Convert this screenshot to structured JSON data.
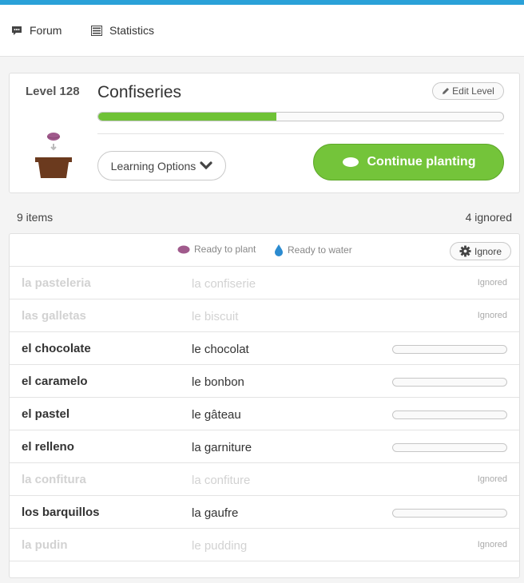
{
  "nav": {
    "items": [
      {
        "label": "Forum",
        "icon": "speech-bubble-icon"
      },
      {
        "label": "Statistics",
        "icon": "list-table-icon"
      }
    ]
  },
  "level": {
    "label": "Level 128",
    "title": "Confiseries",
    "edit_label": "Edit Level",
    "progress": 0.44,
    "learning_options_label": "Learning Options",
    "continue_label": "Continue planting"
  },
  "summary": {
    "items": "9 items",
    "ignored": "4 ignored"
  },
  "list": {
    "legend_plant": "Ready to plant",
    "legend_water": "Ready to water",
    "ignore_label": "Ignore",
    "rows": [
      {
        "word": "la pasteleria",
        "definition": "la confiserie",
        "ignored": true,
        "status": "Ignored"
      },
      {
        "word": "las galletas",
        "definition": "le biscuit",
        "ignored": true,
        "status": "Ignored"
      },
      {
        "word": "el chocolate",
        "definition": "le chocolat",
        "ignored": false,
        "progress": 0
      },
      {
        "word": "el caramelo",
        "definition": "le bonbon",
        "ignored": false,
        "progress": 0
      },
      {
        "word": "el pastel",
        "definition": "le gâteau",
        "ignored": false,
        "progress": 0
      },
      {
        "word": "el relleno",
        "definition": "la garniture",
        "ignored": false,
        "progress": 0
      },
      {
        "word": "la confitura",
        "definition": "la confiture",
        "ignored": true,
        "status": "Ignored"
      },
      {
        "word": "los barquillos",
        "definition": "la gaufre",
        "ignored": false,
        "progress": 0
      },
      {
        "word": "la pudin",
        "definition": "le pudding",
        "ignored": true,
        "status": "Ignored"
      }
    ]
  },
  "colors": {
    "accent_blue": "#2aa1d8",
    "green": "#74c43a",
    "seed_purple": "#a05a8c",
    "water_blue": "#2b8bd0",
    "pot_brown": "#6b3a1e"
  }
}
